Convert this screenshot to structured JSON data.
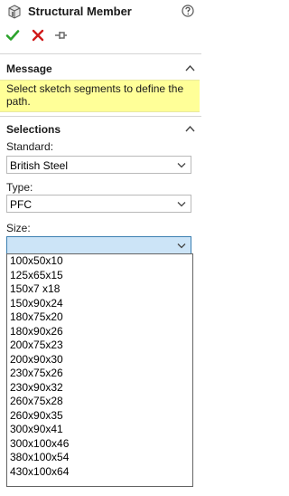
{
  "header": {
    "title": "Structural Member"
  },
  "toolbar": {
    "ok_icon": "check-icon",
    "cancel_icon": "x-icon",
    "pin_icon": "pushpin-icon"
  },
  "message": {
    "title": "Message",
    "text": "Select sketch segments to define the path."
  },
  "selections": {
    "title": "Selections",
    "standard": {
      "label": "Standard:",
      "value": "British Steel"
    },
    "type": {
      "label": "Type:",
      "value": "PFC"
    },
    "size": {
      "label": "Size:",
      "value": "",
      "options": [
        "100x50x10",
        "125x65x15",
        "150x7 x18",
        "150x90x24",
        "180x75x20",
        "180x90x26",
        "200x75x23",
        "200x90x30",
        "230x75x26",
        "230x90x32",
        "260x75x28",
        "260x90x35",
        "300x90x41",
        "300x100x46",
        "380x100x54",
        "430x100x64"
      ]
    }
  },
  "colors": {
    "message_bg": "#ffff98",
    "accent": "#3c7fb1",
    "ok_green": "#2ca32c",
    "cancel_red": "#d11a1a"
  }
}
